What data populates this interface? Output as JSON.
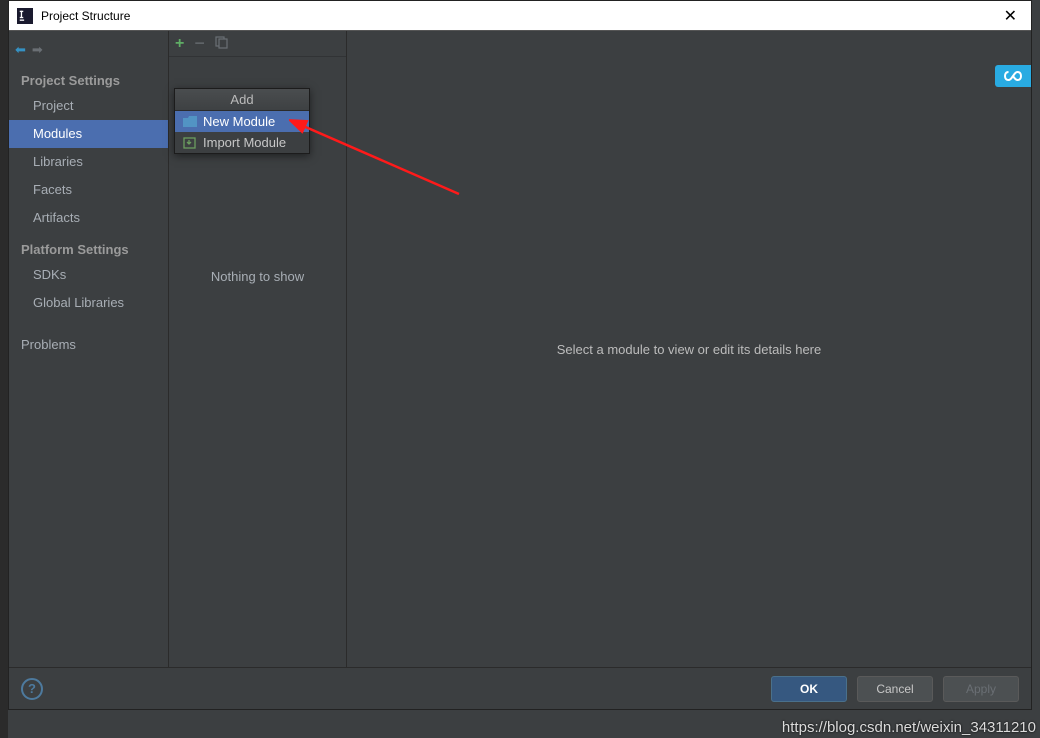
{
  "window": {
    "title": "Project Structure"
  },
  "sidebar": {
    "sections": {
      "project_settings": {
        "header": "Project Settings",
        "items": [
          {
            "label": "Project"
          },
          {
            "label": "Modules"
          },
          {
            "label": "Libraries"
          },
          {
            "label": "Facets"
          },
          {
            "label": "Artifacts"
          }
        ]
      },
      "platform_settings": {
        "header": "Platform Settings",
        "items": [
          {
            "label": "SDKs"
          },
          {
            "label": "Global Libraries"
          }
        ]
      },
      "problems": {
        "items": [
          {
            "label": "Problems"
          }
        ]
      }
    }
  },
  "mid": {
    "empty": "Nothing to show"
  },
  "popup": {
    "header": "Add",
    "items": [
      {
        "label": "New Module"
      },
      {
        "label": "Import Module"
      }
    ]
  },
  "detail": {
    "placeholder": "Select a module to view or edit its details here"
  },
  "footer": {
    "ok": "OK",
    "cancel": "Cancel",
    "apply": "Apply"
  },
  "watermark": "https://blog.csdn.net/weixin_34311210"
}
